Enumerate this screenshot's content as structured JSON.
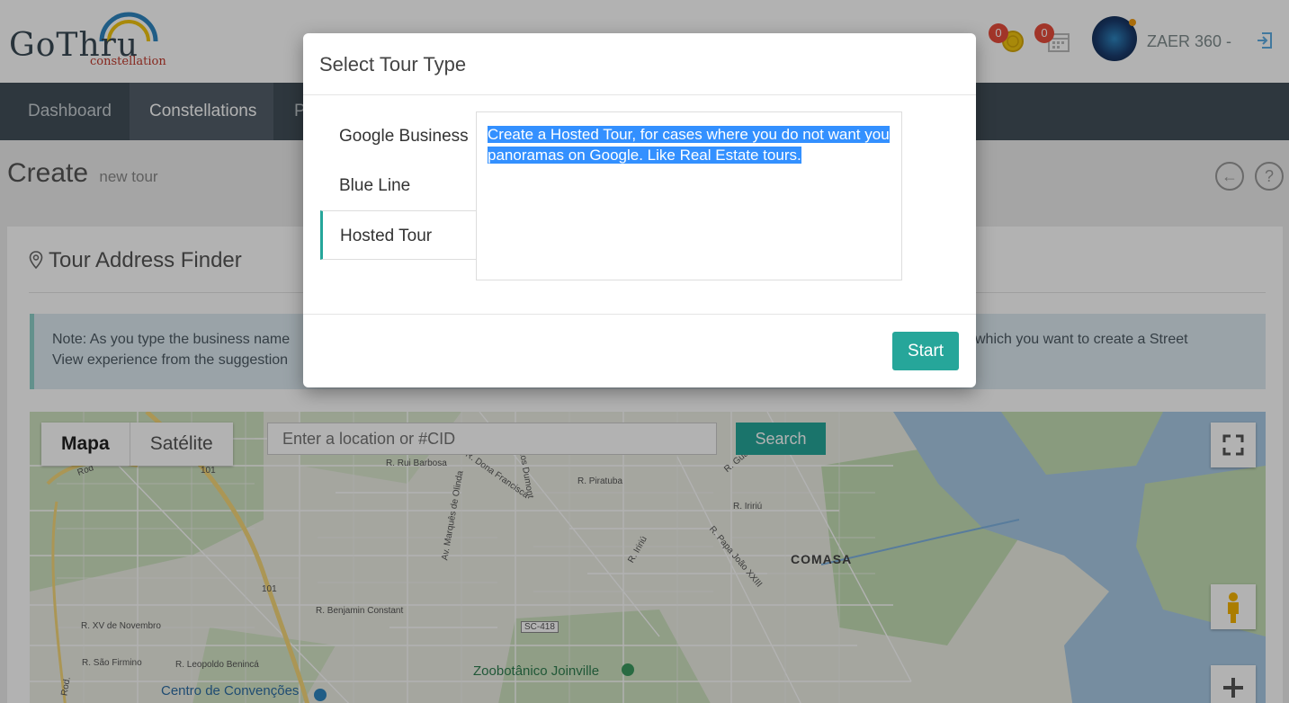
{
  "header": {
    "logo_text": "GoThru",
    "logo_sub": "constellation",
    "notifications_count": "0",
    "calendar_count": "0",
    "username": "ZAER 360 -"
  },
  "nav": {
    "items": [
      {
        "label": "Dashboard"
      },
      {
        "label": "Constellations"
      },
      {
        "label": "P"
      }
    ]
  },
  "page": {
    "title": "Create",
    "subtitle": "new tour"
  },
  "finder": {
    "title": "Tour Address Finder",
    "note_left": "Note: As you type the business name View experience from the suggestion",
    "note_right": "which you want to create a Street"
  },
  "map": {
    "type_options": [
      "Mapa",
      "Satélite"
    ],
    "search_placeholder": "Enter a location or #CID",
    "search_button": "Search",
    "labels": {
      "comasa": "COMASA",
      "zoo": "Zoobotânico Joinville",
      "centro": "Centro de Convenções",
      "r_xv": "R. XV de Novembro",
      "r_benjamin": "R. Benjamin Constant",
      "r_sao_firmino": "R. São Firmino",
      "r_leopoldo": "R. Leopoldo Benincá",
      "r_piratuba": "R. Piratuba",
      "r_iririu": "R. Iririú",
      "r_papa": "R. Papa João XXIII",
      "sc418": "SC-418",
      "br101a": "101",
      "br101b": "101",
      "r_rui": "R. Rui Barbosa",
      "r_dona": "R. Dona Francisca",
      "av_marques": "Av. Marquês de Olinda",
      "santos_dumont": "antos Dumont",
      "r_guai": "R. Gua",
      "r_iririu2": "R. Iririú",
      "rod": "Rod.",
      "rod2": "Rod"
    }
  },
  "modal": {
    "title": "Select Tour Type",
    "tabs": [
      {
        "label": "Google Business"
      },
      {
        "label": "Blue Line"
      },
      {
        "label": "Hosted Tour"
      }
    ],
    "active_tab": 2,
    "content": "Create a Hosted Tour, for cases where you do not want you panoramas on Google. Like Real Estate tours.",
    "start_button": "Start"
  },
  "colors": {
    "accent": "#26a69a",
    "nav_bg": "#434f59",
    "badge": "#e74c3c",
    "selection": "#3390ff"
  }
}
